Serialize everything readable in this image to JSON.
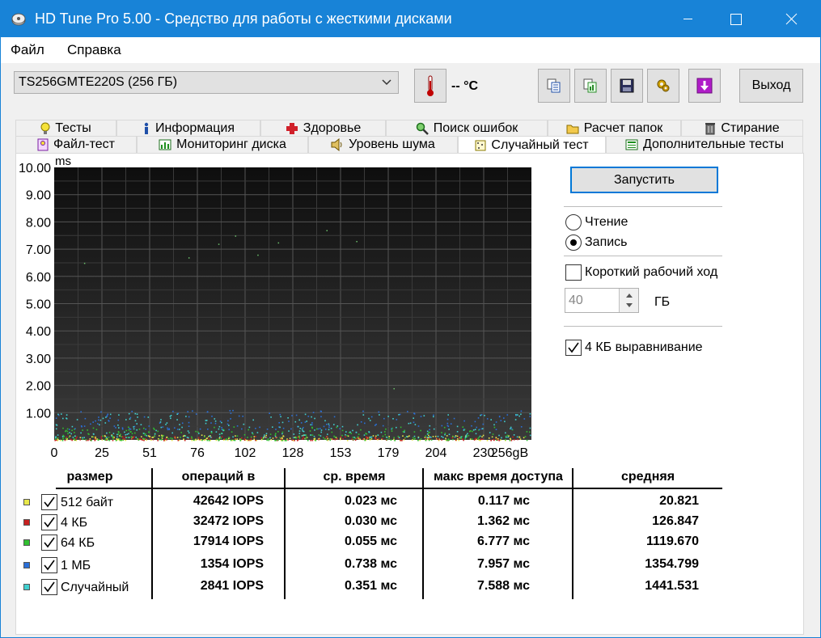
{
  "window": {
    "title": "HD Tune Pro 5.00 - Средство для работы с жесткими дисками",
    "title_bar_color": "#1883d7"
  },
  "menu": {
    "file": "Файл",
    "help": "Справка"
  },
  "toolbar": {
    "drive": "TS256GMTE220S (256 ГБ)",
    "temperature": "-- °C",
    "exit_label": "Выход",
    "icons": [
      "thermometer-icon",
      "copy-text-icon",
      "copy-image-icon",
      "save-icon",
      "options-icon",
      "download-icon"
    ]
  },
  "tabs": {
    "row1": [
      "Тесты",
      "Информация",
      "Здоровье",
      "Поиск ошибок",
      "Расчет папок",
      "Стирание"
    ],
    "row2": [
      "Файл-тест",
      "Мониторинг диска",
      "Уровень шума",
      "Случайный тест",
      "Дополнительные тесты"
    ],
    "active": "Случайный тест"
  },
  "controls": {
    "run_label": "Запустить",
    "read_label": "Чтение",
    "write_label": "Запись",
    "mode_selected": "write",
    "short_stroke_label": "Короткий рабочий ход",
    "short_stroke_checked": false,
    "short_stroke_value": "40",
    "short_stroke_unit": "ГБ",
    "align_label": "4 КБ выравнивание",
    "align_checked": true
  },
  "chart_data": {
    "type": "scatter",
    "ylabel": "ms",
    "xlabel": "gB",
    "ylim": [
      0,
      10
    ],
    "xlim": [
      0,
      256
    ],
    "y_ticks": [
      "10.00",
      "9.00",
      "8.00",
      "7.00",
      "6.00",
      "5.00",
      "4.00",
      "3.00",
      "2.00",
      "1.00"
    ],
    "x_ticks": [
      "0",
      "25",
      "51",
      "76",
      "102",
      "128",
      "153",
      "179",
      "204",
      "230",
      "256gB"
    ],
    "grid": true,
    "background": "#1c1c1c",
    "series": [
      {
        "name": "512 байт",
        "color": "#e8e84a",
        "y_range": [
          0.0,
          0.2
        ]
      },
      {
        "name": "4 КБ",
        "color": "#c82020",
        "y_range": [
          0.0,
          0.15
        ]
      },
      {
        "name": "64 КБ",
        "color": "#30c030",
        "y_range": [
          0.0,
          0.5
        ]
      },
      {
        "name": "1 МБ",
        "color": "#2a6fd8",
        "y_range": [
          0.4,
          1.1
        ]
      },
      {
        "name": "Случайный",
        "color": "#40d0d0",
        "y_range": [
          0.1,
          1.0
        ]
      }
    ],
    "outliers": [
      {
        "x": 16,
        "y": 6.5
      },
      {
        "x": 72,
        "y": 6.7
      },
      {
        "x": 88,
        "y": 7.2
      },
      {
        "x": 97,
        "y": 7.5
      },
      {
        "x": 120,
        "y": 7.25
      },
      {
        "x": 109,
        "y": 6.8
      },
      {
        "x": 146,
        "y": 7.7
      },
      {
        "x": 162,
        "y": 7.3
      },
      {
        "x": 182,
        "y": 1.9
      }
    ]
  },
  "table": {
    "headers": [
      "размер",
      "операций в",
      "ср. время",
      "макс время доступа",
      "средняя"
    ],
    "rows": [
      {
        "label": "512 байт",
        "color": "#e8e84a",
        "checked": true,
        "iops": "42642 IOPS",
        "avg": "0.023 мс",
        "max": "0.117 мс",
        "mean": "20.821"
      },
      {
        "label": "4 КБ",
        "color": "#c82020",
        "checked": true,
        "iops": "32472 IOPS",
        "avg": "0.030 мс",
        "max": "1.362 мс",
        "mean": "126.847"
      },
      {
        "label": "64 КБ",
        "color": "#30c030",
        "checked": true,
        "iops": "17914 IOPS",
        "avg": "0.055 мс",
        "max": "6.777 мс",
        "mean": "1119.670"
      },
      {
        "label": "1 МБ",
        "color": "#2a6fd8",
        "checked": true,
        "iops": "1354 IOPS",
        "avg": "0.738 мс",
        "max": "7.957 мс",
        "mean": "1354.799"
      },
      {
        "label": "Случайный",
        "color": "#40d0d0",
        "checked": true,
        "iops": "2841 IOPS",
        "avg": "0.351 мс",
        "max": "7.588 мс",
        "mean": "1441.531"
      }
    ]
  }
}
